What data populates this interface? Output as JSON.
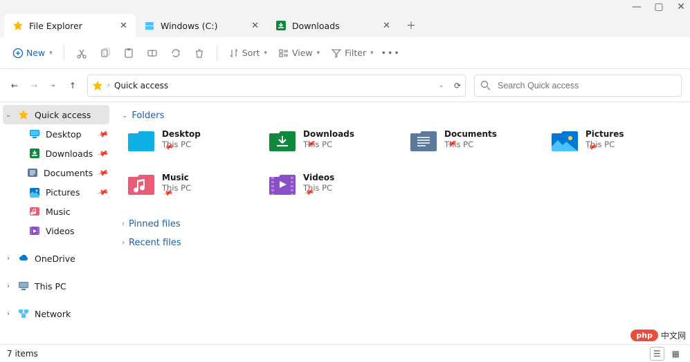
{
  "window_controls": {
    "minimize": "—",
    "maximize": "▢",
    "close": "✕"
  },
  "tabs": [
    {
      "icon": "star",
      "label": "File Explorer",
      "active": true
    },
    {
      "icon": "drive",
      "label": "Windows (C:)",
      "active": false
    },
    {
      "icon": "download",
      "label": "Downloads",
      "active": false
    }
  ],
  "toolbar": {
    "new_label": "New",
    "sort_label": "Sort",
    "view_label": "View",
    "filter_label": "Filter"
  },
  "address": {
    "location": "Quick access",
    "search_placeholder": "Search Quick access"
  },
  "sidebar": {
    "items": [
      {
        "icon": "star",
        "label": "Quick access",
        "expander": "down",
        "selected": true,
        "pin": false
      },
      {
        "icon": "desktop",
        "label": "Desktop",
        "child": true,
        "pin": true
      },
      {
        "icon": "download",
        "label": "Downloads",
        "child": true,
        "pin": true
      },
      {
        "icon": "document",
        "label": "Documents",
        "child": true,
        "pin": true
      },
      {
        "icon": "picture",
        "label": "Pictures",
        "child": true,
        "pin": true
      },
      {
        "icon": "music",
        "label": "Music",
        "child": true,
        "pin": false
      },
      {
        "icon": "video",
        "label": "Videos",
        "child": true,
        "pin": false
      },
      {
        "gap": true
      },
      {
        "icon": "onedrive",
        "label": "OneDrive",
        "expander": "right",
        "pin": false
      },
      {
        "gap": true
      },
      {
        "icon": "thispc",
        "label": "This PC",
        "expander": "right",
        "pin": false
      },
      {
        "gap": true
      },
      {
        "icon": "network",
        "label": "Network",
        "expander": "right",
        "pin": false
      }
    ]
  },
  "sections": {
    "folders": "Folders",
    "pinned": "Pinned files",
    "recent": "Recent files"
  },
  "folders": [
    {
      "name": "Desktop",
      "sub": "This PC",
      "color": "desktop"
    },
    {
      "name": "Downloads",
      "sub": "This PC",
      "color": "download"
    },
    {
      "name": "Documents",
      "sub": "This PC",
      "color": "document"
    },
    {
      "name": "Pictures",
      "sub": "This PC",
      "color": "picture"
    },
    {
      "name": "Music",
      "sub": "This PC",
      "color": "music"
    },
    {
      "name": "Videos",
      "sub": "This PC",
      "color": "video"
    }
  ],
  "status": {
    "items": "7 items"
  },
  "watermark": {
    "pill": "php",
    "text": "中文网"
  }
}
